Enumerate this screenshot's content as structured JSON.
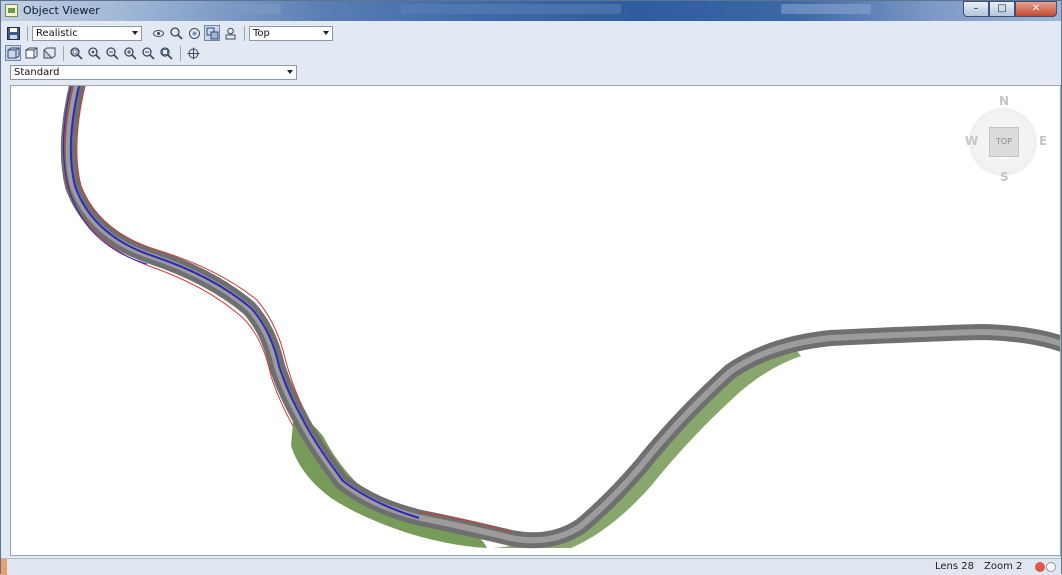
{
  "window": {
    "title": "Object Viewer"
  },
  "toolbar1": {
    "visual_style": "Realistic",
    "view_direction": "Top",
    "icons": [
      "save-icon",
      "orbit-icon",
      "zoom-icon",
      "realtime-zoom-icon",
      "view-options-icon",
      "camera-icon"
    ]
  },
  "toolbar2": {
    "icons": [
      "3d-wireframe-icon",
      "3d-hidden-icon",
      "3d-shaded-icon",
      "zoom-window-icon",
      "zoom-dynamic-icon",
      "zoom-scale-icon",
      "zoom-in-icon",
      "zoom-out-icon",
      "zoom-extents-icon",
      "pan-icon"
    ]
  },
  "view_profile": {
    "selected": "Standard"
  },
  "viewcube": {
    "face": "TOP",
    "north": "N",
    "south": "S",
    "east": "E",
    "west": "W"
  },
  "status": {
    "lens": "Lens 28",
    "zoom": "Zoom 2"
  },
  "colors": {
    "road": "#7d7d7d",
    "green_fill": "#5f8a3c",
    "blue_line": "#2a2abb",
    "red_line": "#d03a3a"
  }
}
